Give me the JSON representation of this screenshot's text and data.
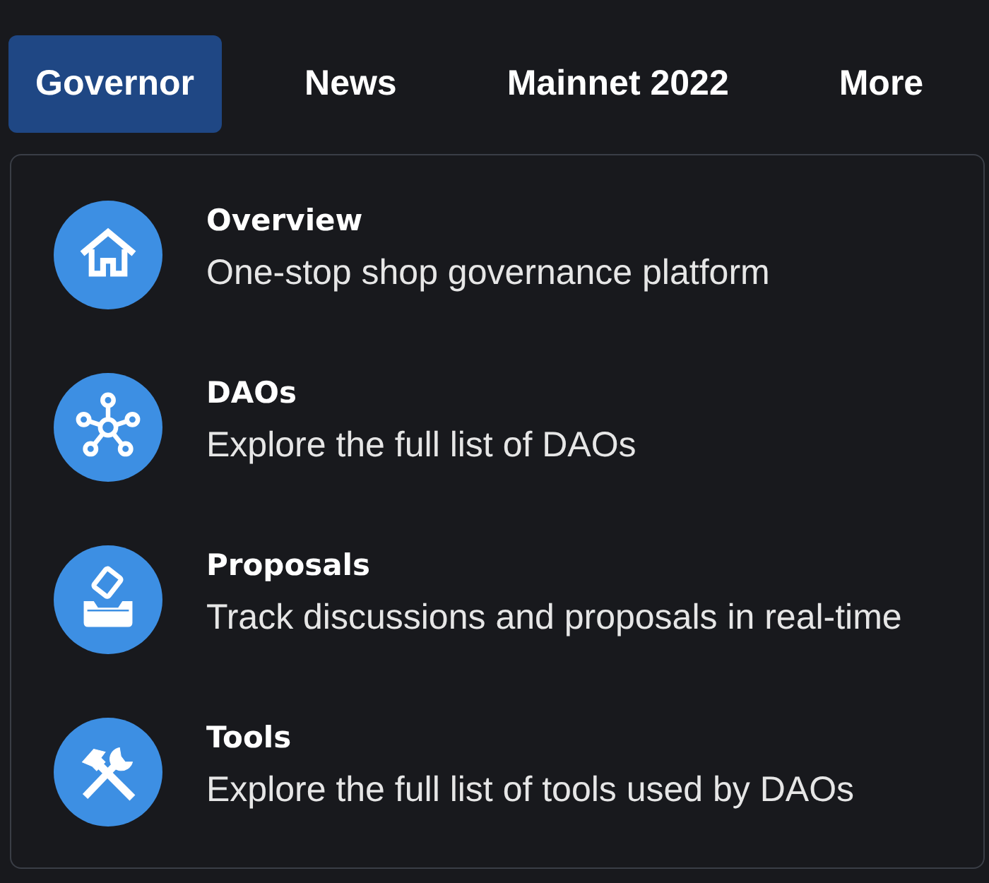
{
  "nav": {
    "tabs": [
      {
        "label": "Governor",
        "selected": true
      },
      {
        "label": "News",
        "selected": false
      },
      {
        "label": "Mainnet 2022",
        "selected": false
      },
      {
        "label": "More",
        "selected": false
      }
    ]
  },
  "menu": {
    "items": [
      {
        "kind": "home",
        "title": "Overview",
        "description": "One-stop shop governance platform"
      },
      {
        "kind": "network",
        "title": "DAOs",
        "description": "Explore the full list of DAOs"
      },
      {
        "kind": "ballot",
        "title": "Proposals",
        "description": "Track discussions and proposals in real-time"
      },
      {
        "kind": "tools",
        "title": "Tools",
        "description": "Explore the full list of tools used by DAOs"
      }
    ]
  }
}
